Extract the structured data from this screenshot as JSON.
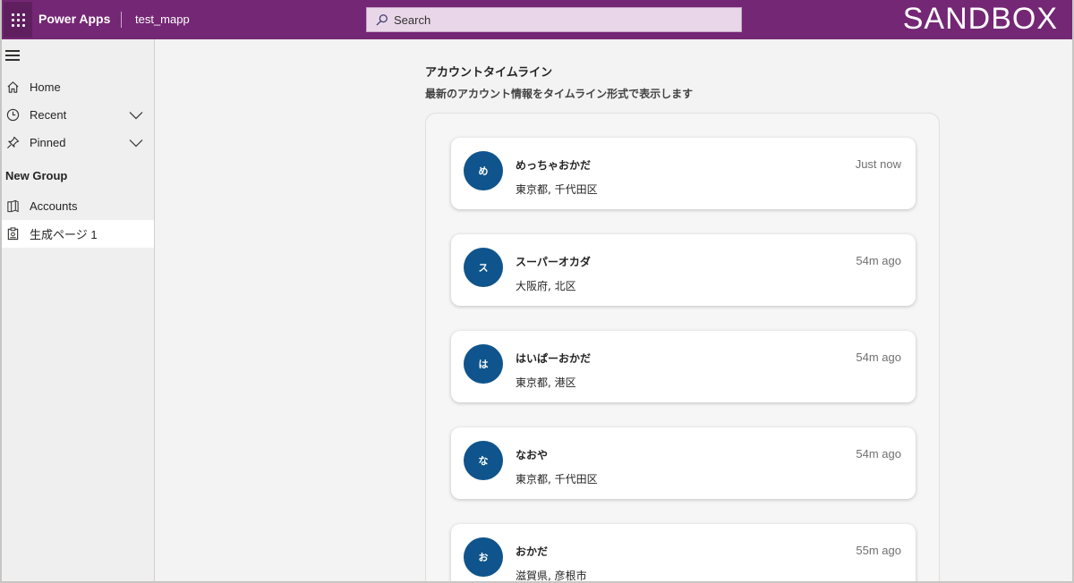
{
  "header": {
    "app_title": "Power Apps",
    "app_name": "test_mapp",
    "search_placeholder": "Search",
    "environment": "SANDBOX",
    "colors": {
      "bar": "#742774",
      "waffle": "#5f1f5f",
      "search_bg": "#e9d7e9"
    }
  },
  "sidebar": {
    "items": [
      {
        "label": "Home",
        "icon": "home-icon"
      },
      {
        "label": "Recent",
        "icon": "clock-icon",
        "expandable": true
      },
      {
        "label": "Pinned",
        "icon": "pin-icon",
        "expandable": true
      }
    ],
    "group": {
      "label": "New Group",
      "items": [
        {
          "label": "Accounts",
          "icon": "entity-icon"
        },
        {
          "label": "生成ページ 1",
          "icon": "generated-page-icon",
          "active": true
        }
      ]
    }
  },
  "main": {
    "title": "アカウントタイムライン",
    "subtitle": "最新のアカウント情報をタイムライン形式で表示します",
    "accent_color": "#0f548c",
    "timeline": [
      {
        "initial": "め",
        "name": "めっちゃおかだ",
        "location": "東京都, 千代田区",
        "time": "Just now"
      },
      {
        "initial": "ス",
        "name": "スーパーオカダ",
        "location": "大阪府, 北区",
        "time": "54m ago"
      },
      {
        "initial": "は",
        "name": "はいぱーおかだ",
        "location": "東京都, 港区",
        "time": "54m ago"
      },
      {
        "initial": "な",
        "name": "なおや",
        "location": "東京都, 千代田区",
        "time": "54m ago"
      },
      {
        "initial": "お",
        "name": "おかだ",
        "location": "滋賀県, 彦根市",
        "time": "55m ago"
      }
    ]
  }
}
